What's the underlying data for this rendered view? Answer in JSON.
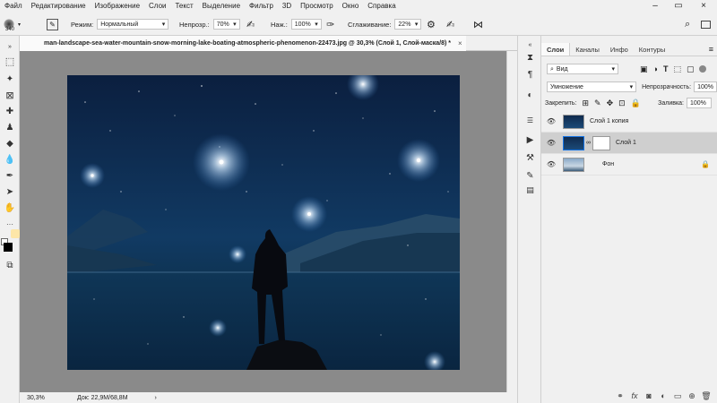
{
  "menu": [
    "Файл",
    "Редактирование",
    "Изображение",
    "Слои",
    "Текст",
    "Выделение",
    "Фильтр",
    "3D",
    "Просмотр",
    "Окно",
    "Справка"
  ],
  "options": {
    "brush_size": "340",
    "mode_label": "Режим:",
    "mode_value": "Нормальный",
    "opacity_label": "Непрозр.:",
    "opacity_value": "70%",
    "flow_label": "Наж.:",
    "flow_value": "100%",
    "smoothing_label": "Сглаживание:",
    "smoothing_value": "22%"
  },
  "document": {
    "tab_title": "man-landscape-sea-water-mountain-snow-morning-lake-boating-atmospheric-phenomenon-22473.jpg @ 30,3% (Слой 1, Слой-маска/8) *",
    "close": "×",
    "zoom": "30,3%",
    "doc_size": "Док: 22,9M/68,8M",
    "status_arrow": "›"
  },
  "panel": {
    "tabs": [
      "Слои",
      "Каналы",
      "Инфо",
      "Контуры"
    ],
    "filter_label": "Вид",
    "blend_mode": "Умножение",
    "opacity_label": "Непрозрачность:",
    "opacity_value": "100%",
    "lock_label": "Закрепить:",
    "fill_label": "Заливка:",
    "fill_value": "100%",
    "layers": [
      {
        "name": "Слой 1 копия"
      },
      {
        "name": "Слой 1"
      },
      {
        "name": "Фон"
      }
    ]
  },
  "colors": {
    "accent": "#1473e6",
    "canvas_bg": "#0a1d36"
  }
}
